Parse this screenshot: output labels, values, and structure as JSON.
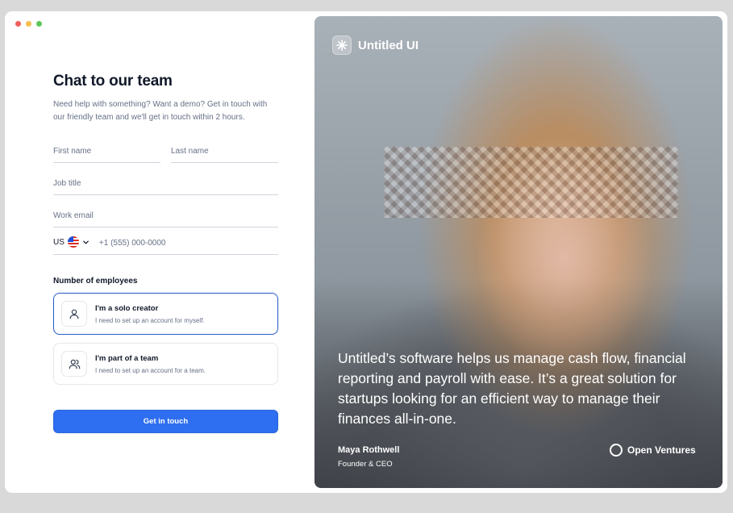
{
  "form": {
    "title": "Chat to our team",
    "subtitle": "Need help with something? Want a demo? Get in touch with our friendly team and we'll get in touch within 2 hours.",
    "first_name_placeholder": "First name",
    "last_name_placeholder": "Last name",
    "job_title_placeholder": "Job title",
    "work_email_placeholder": "Work email",
    "country_code": "US",
    "phone_placeholder": "+1 (555) 000-0000",
    "employees_label": "Number of employees",
    "options": [
      {
        "title": "I'm a solo creator",
        "description": "I need to set up an account for myself.",
        "icon": "user-icon",
        "selected": true
      },
      {
        "title": "I'm part of a team",
        "description": "I need to set up an account for a team.",
        "icon": "users-icon",
        "selected": false
      }
    ],
    "submit_label": "Get in touch"
  },
  "hero": {
    "brand": "Untitled UI",
    "quote": "Untitled’s software helps us manage cash flow, financial reporting and payroll with ease. It’s a great solution for startups looking for an efficient way to manage their finances all-in-one.",
    "author_name": "Maya Rothwell",
    "author_role": "Founder & CEO",
    "company": "Open Ventures"
  },
  "colors": {
    "accent": "#2e6ef0",
    "selected_border": "#2f5fc9",
    "text_primary": "#101828",
    "text_secondary": "#667085"
  }
}
